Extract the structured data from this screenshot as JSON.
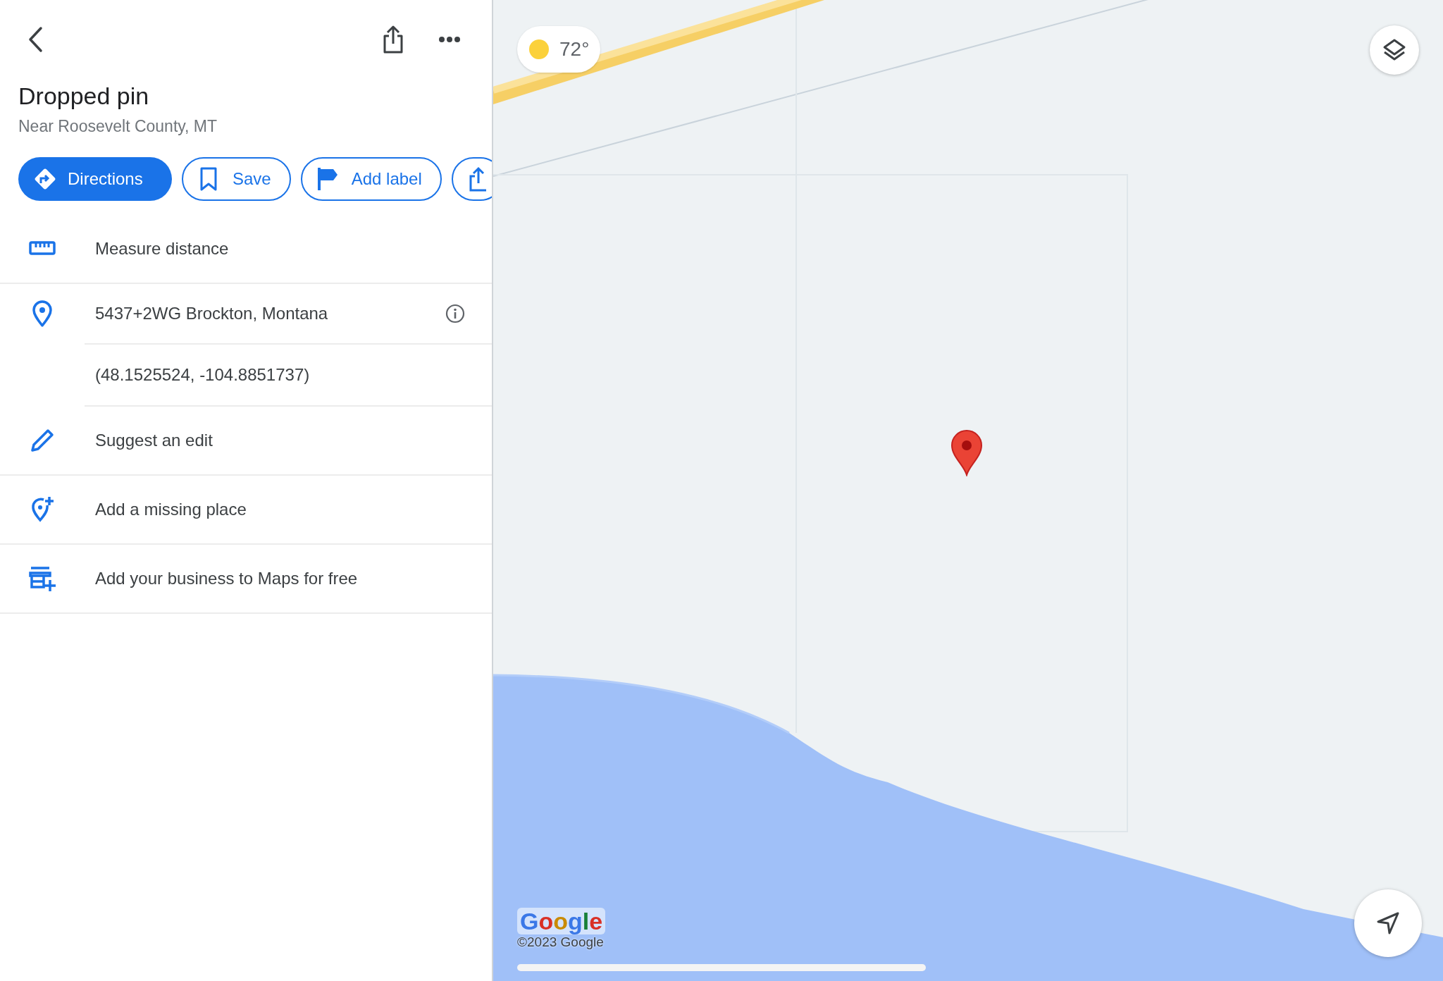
{
  "place": {
    "title": "Dropped pin",
    "subtitle": "Near Roosevelt County, MT"
  },
  "actions": [
    {
      "kind": "primary",
      "label": "Directions"
    },
    {
      "kind": "save",
      "label": "Save"
    },
    {
      "kind": "label",
      "label": "Add label"
    },
    {
      "kind": "share"
    }
  ],
  "details": [
    {
      "kind": "measure",
      "text": "Measure distance"
    },
    {
      "kind": "plus_code",
      "text": "5437+2WG Brockton, Montana"
    },
    {
      "kind": "coordinates",
      "text": "(48.1525524, -104.8851737)"
    },
    {
      "kind": "edit",
      "text": "Suggest an edit"
    },
    {
      "kind": "missing_place",
      "text": "Add a missing place"
    },
    {
      "kind": "business",
      "text": "Add your business to Maps for free"
    }
  ],
  "map": {
    "weather": {
      "temperature": "72°"
    },
    "attribution": {
      "logo": "Google",
      "copyright": "©2023 Google"
    }
  }
}
